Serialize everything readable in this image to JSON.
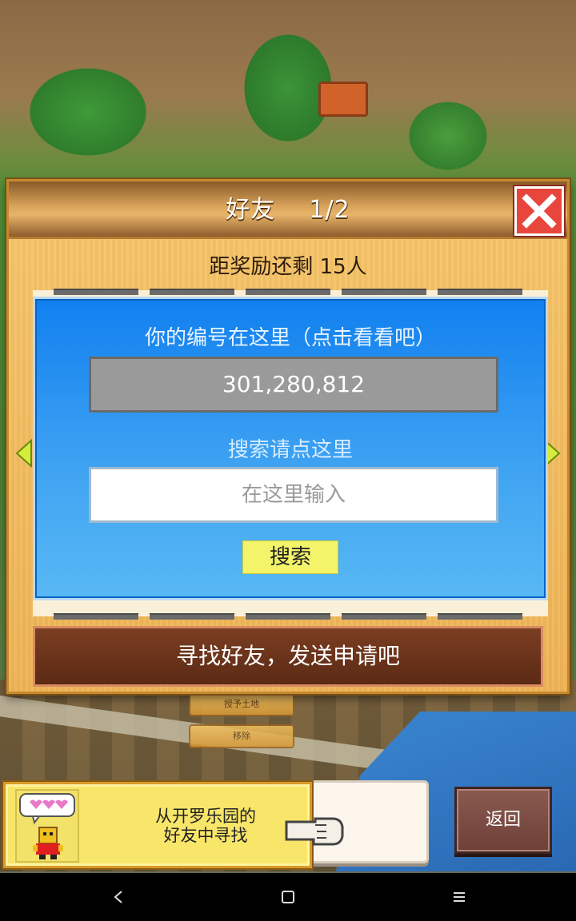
{
  "dialog": {
    "title": "好友",
    "page": "1/2",
    "reward_text": "距奖励还剩 15人",
    "id_label": "你的编号在这里（点击看看吧）",
    "id_value": "301,280,812",
    "search_label": "搜索请点这里",
    "search_placeholder": "在这里输入",
    "search_button": "搜索",
    "find_friends": "寻找好友，发送申请吧"
  },
  "background": {
    "button_1": "授予土地",
    "button_2": "移除"
  },
  "tip": {
    "line1": "从开罗乐园的",
    "line2": "好友中寻找"
  },
  "return_button": "返回",
  "icons": {
    "close": "close-x-icon",
    "prev": "arrow-left-icon",
    "next": "arrow-right-icon",
    "nav_back": "nav-back-icon",
    "nav_home": "nav-home-icon",
    "nav_menu": "nav-menu-icon"
  },
  "colors": {
    "panel_blue": "#1180f0",
    "close_red": "#e8463c",
    "search_yellow": "#f4f46a",
    "find_bar_brown": "#6b3219"
  }
}
